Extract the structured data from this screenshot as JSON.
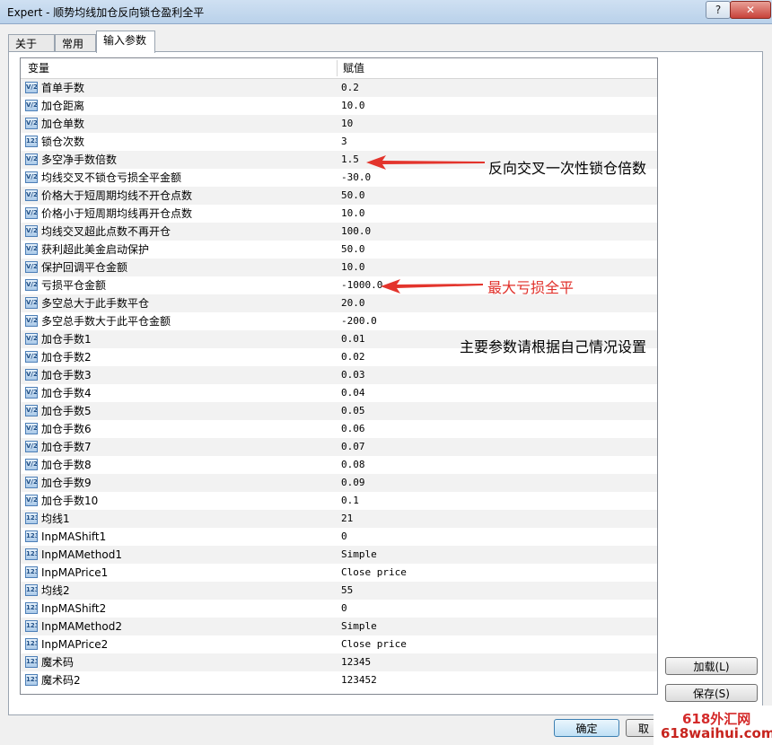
{
  "window": {
    "title": "Expert - 顺势均线加仓反向锁仓盈利全平",
    "help_label": "?",
    "close_label": "✕"
  },
  "tabs": [
    {
      "label": "关于"
    },
    {
      "label": "常用"
    },
    {
      "label": "输入参数",
      "active": true
    }
  ],
  "grid": {
    "columns": [
      "变量",
      "赋值"
    ],
    "rows": [
      {
        "icon": "V/2",
        "name": "首单手数",
        "value": "0.2"
      },
      {
        "icon": "V/2",
        "name": "加仓距离",
        "value": "10.0"
      },
      {
        "icon": "V/2",
        "name": "加仓单数",
        "value": "10"
      },
      {
        "icon": "123",
        "name": "锁仓次数",
        "value": "3"
      },
      {
        "icon": "V/2",
        "name": "多空净手数倍数",
        "value": "1.5"
      },
      {
        "icon": "V/2",
        "name": "均线交叉不锁仓亏损全平金额",
        "value": "-30.0"
      },
      {
        "icon": "V/2",
        "name": "价格大于短周期均线不开仓点数",
        "value": "50.0"
      },
      {
        "icon": "V/2",
        "name": "价格小于短周期均线再开仓点数",
        "value": "10.0"
      },
      {
        "icon": "V/2",
        "name": "均线交叉超此点数不再开仓",
        "value": "100.0"
      },
      {
        "icon": "V/2",
        "name": "获利超此美金启动保护",
        "value": "50.0"
      },
      {
        "icon": "V/2",
        "name": "保护回调平仓金额",
        "value": "10.0"
      },
      {
        "icon": "V/2",
        "name": "亏损平仓金额",
        "value": "-1000.0"
      },
      {
        "icon": "V/2",
        "name": "多空总大于此手数平仓",
        "value": "20.0"
      },
      {
        "icon": "V/2",
        "name": "多空总手数大于此平仓金额",
        "value": "-200.0"
      },
      {
        "icon": "V/2",
        "name": "加仓手数1",
        "value": "0.01"
      },
      {
        "icon": "V/2",
        "name": "加仓手数2",
        "value": "0.02"
      },
      {
        "icon": "V/2",
        "name": "加仓手数3",
        "value": "0.03"
      },
      {
        "icon": "V/2",
        "name": "加仓手数4",
        "value": "0.04"
      },
      {
        "icon": "V/2",
        "name": "加仓手数5",
        "value": "0.05"
      },
      {
        "icon": "V/2",
        "name": "加仓手数6",
        "value": "0.06"
      },
      {
        "icon": "V/2",
        "name": "加仓手数7",
        "value": "0.07"
      },
      {
        "icon": "V/2",
        "name": "加仓手数8",
        "value": "0.08"
      },
      {
        "icon": "V/2",
        "name": "加仓手数9",
        "value": "0.09"
      },
      {
        "icon": "V/2",
        "name": "加仓手数10",
        "value": "0.1"
      },
      {
        "icon": "123",
        "name": "均线1",
        "value": "21"
      },
      {
        "icon": "123",
        "name": "InpMAShift1",
        "value": "0"
      },
      {
        "icon": "123",
        "name": "InpMAMethod1",
        "value": "Simple"
      },
      {
        "icon": "123",
        "name": "InpMAPrice1",
        "value": "Close price"
      },
      {
        "icon": "123",
        "name": "均线2",
        "value": "55"
      },
      {
        "icon": "123",
        "name": "InpMAShift2",
        "value": "0"
      },
      {
        "icon": "123",
        "name": "InpMAMethod2",
        "value": "Simple"
      },
      {
        "icon": "123",
        "name": "InpMAPrice2",
        "value": "Close price"
      },
      {
        "icon": "123",
        "name": "魔术码",
        "value": "12345"
      },
      {
        "icon": "123",
        "name": "魔术码2",
        "value": "123452"
      }
    ]
  },
  "annotations": {
    "lock_multiplier_note": "反向交叉一次性锁仓倍数",
    "max_loss_note": "最大亏损全平",
    "main_params_note": "主要参数请根据自己情况设置",
    "colors": {
      "black": "#000000",
      "red": "#e0302a",
      "arrow": "#e3342c"
    }
  },
  "buttons": {
    "load_label": "加载(L)",
    "save_label": "保存(S)",
    "ok_label": "确定",
    "cancel_label": "取"
  },
  "watermark": {
    "line1": "618外汇网",
    "line2": "618waihui.com"
  }
}
